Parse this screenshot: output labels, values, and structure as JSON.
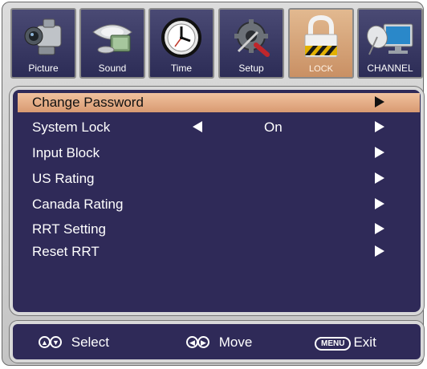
{
  "tabs": [
    {
      "label": "Picture",
      "icon": "camcorder-icon"
    },
    {
      "label": "Sound",
      "icon": "speaker-icon"
    },
    {
      "label": "Time",
      "icon": "clock-icon"
    },
    {
      "label": "Setup",
      "icon": "gear-screwdriver-icon"
    },
    {
      "label": "LOCK",
      "icon": "padlock-icon"
    },
    {
      "label": "CHANNEL",
      "icon": "satellite-dish-icon"
    }
  ],
  "active_tab": "LOCK",
  "menu": {
    "items": [
      {
        "label": "Change Password"
      },
      {
        "label": "System Lock",
        "value": "On"
      },
      {
        "label": "Input Block"
      },
      {
        "label": "US Rating"
      },
      {
        "label": "Canada Rating"
      },
      {
        "label": "RRT Setting"
      },
      {
        "label": "Reset RRT"
      }
    ],
    "selected": "Change Password"
  },
  "footer": {
    "select_label": "Select",
    "move_label": "Move",
    "menu_key": "MENU",
    "exit_label": "Exit"
  },
  "colors": {
    "panel": "#2f2a58",
    "highlight": "#e8b48c",
    "frame": "#d0d0d0"
  }
}
